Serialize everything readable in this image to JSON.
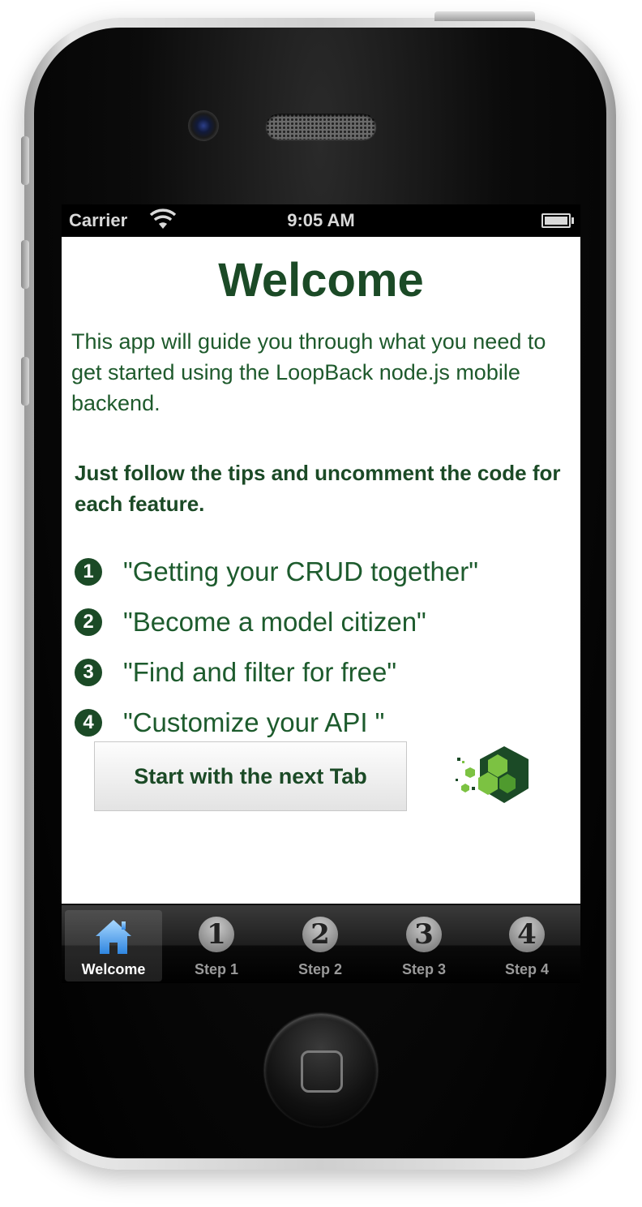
{
  "status_bar": {
    "carrier": "Carrier",
    "time": "9:05 AM"
  },
  "content": {
    "title": "Welcome",
    "intro": "This app will guide you through what you need to get started using the LoopBack node.js mobile backend.",
    "tip": "Just follow the tips and uncomment the code for each feature.",
    "steps": [
      {
        "number": "1",
        "text": "\"Getting your CRUD together\""
      },
      {
        "number": "2",
        "text": "\"Become a model citizen\""
      },
      {
        "number": "3",
        "text": "\"Find and filter for free\""
      },
      {
        "number": "4",
        "text": "\"Customize your API \""
      }
    ],
    "start_button_label": "Start with the next Tab"
  },
  "tab_bar": {
    "tabs": [
      {
        "label": "Welcome",
        "icon": "home-icon",
        "active": true
      },
      {
        "label": "Step 1",
        "icon": "number-1-icon",
        "glyph": "1"
      },
      {
        "label": "Step 2",
        "icon": "number-2-icon",
        "glyph": "2"
      },
      {
        "label": "Step 3",
        "icon": "number-3-icon",
        "glyph": "3"
      },
      {
        "label": "Step 4",
        "icon": "number-4-icon",
        "glyph": "4"
      }
    ]
  },
  "colors": {
    "brand_green": "#1b4a26",
    "tab_active_icon": "#4aa3f0",
    "logo_light_green": "#7cc242"
  }
}
